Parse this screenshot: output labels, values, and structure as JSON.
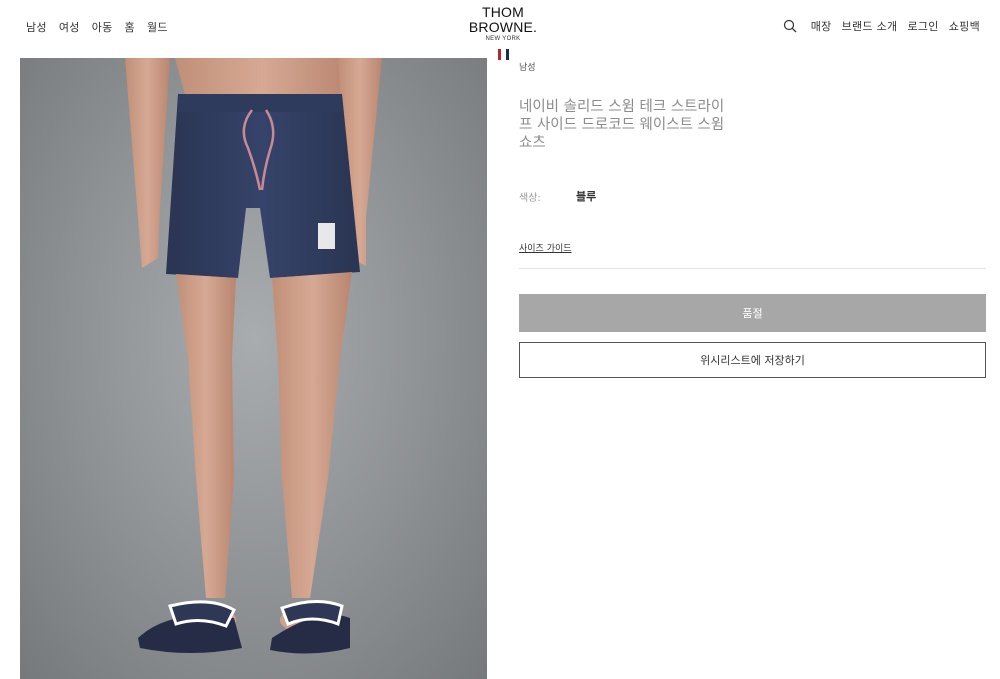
{
  "header": {
    "nav_left": [
      "남성",
      "여성",
      "아동",
      "홈",
      "월드"
    ],
    "logo": {
      "main": "THOM BROWNE.",
      "sub": "NEW YORK"
    },
    "nav_right": [
      "매장",
      "브랜드 소개",
      "로그인",
      "쇼핑백"
    ],
    "flag_colors": [
      "#b3262f",
      "#ffffff",
      "#1e2b55"
    ]
  },
  "product": {
    "category": "남성",
    "title": "네이비 솔리드 스윔 테크 스트라이프 사이드 드로코드 웨이스트 스윔 쇼츠",
    "color_label": "색상:",
    "color_value": "블루",
    "size_guide": "사이즈 가이드",
    "sold_out_label": "품절",
    "wishlist_label": "위시리스트에 저장하기"
  }
}
